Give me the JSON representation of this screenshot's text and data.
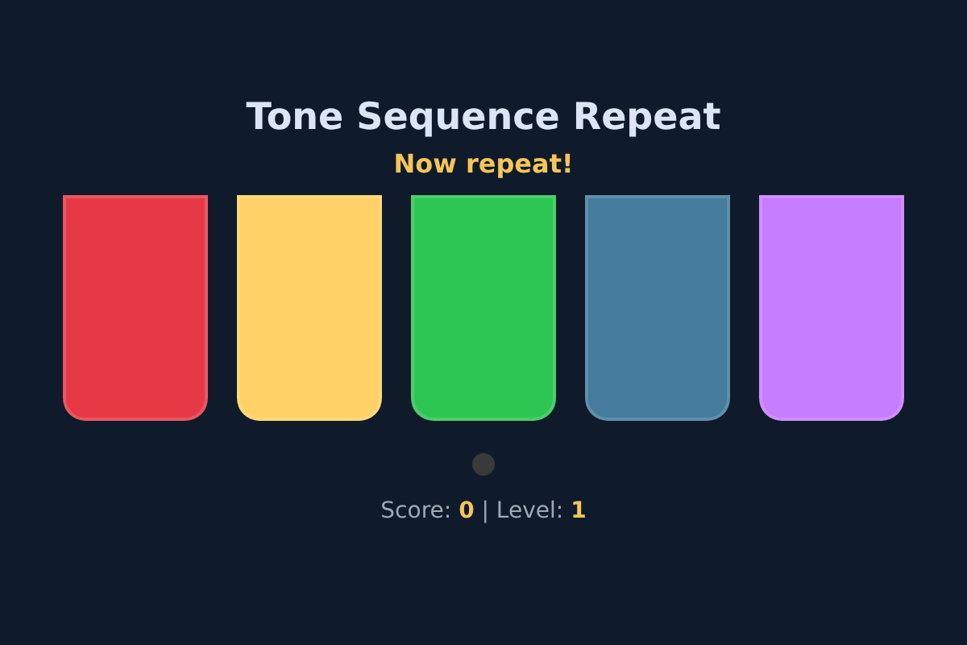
{
  "title": "Tone Sequence Repeat",
  "status": "Now repeat!",
  "pads": [
    {
      "color": "#e63946"
    },
    {
      "color": "#ffd166"
    },
    {
      "color": "#2dc653"
    },
    {
      "color": "#457b9d"
    },
    {
      "color": "#c77dff"
    }
  ],
  "score_line": "Score: **0** | Level: **1**"
}
